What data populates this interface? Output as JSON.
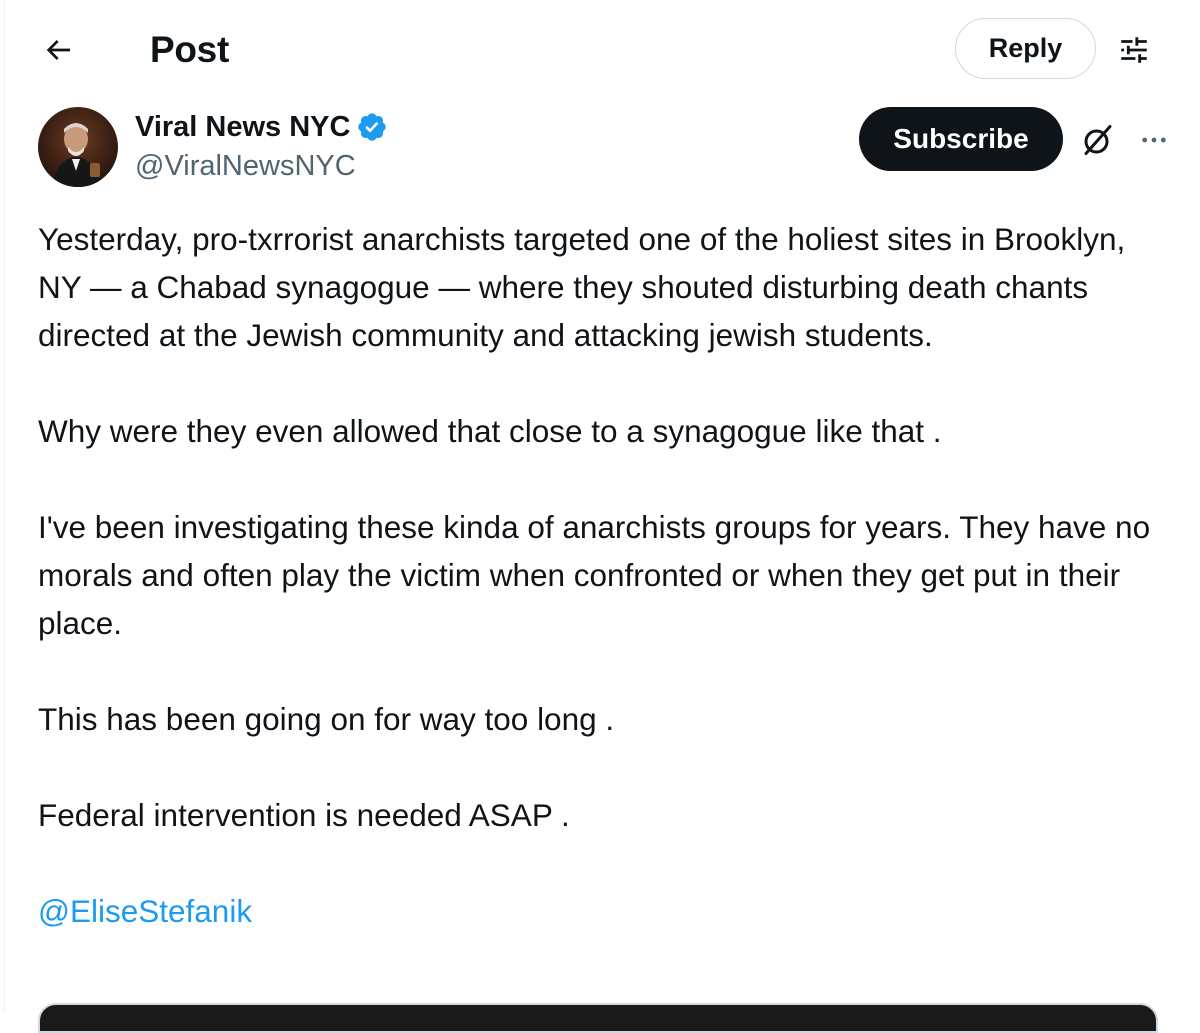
{
  "header": {
    "title": "Post",
    "reply_label": "Reply"
  },
  "author": {
    "name": "Viral News NYC",
    "handle": "@ViralNewsNYC",
    "verified": true,
    "subscribe_label": "Subscribe"
  },
  "post": {
    "paragraphs": [
      "Yesterday, pro-txrrorist anarchists targeted one of the holiest sites in Brooklyn, NY — a Chabad synagogue — where they shouted disturbing death chants directed at the Jewish community and attacking jewish students.",
      "Why were they even allowed that close to a synagogue like that .",
      "I've been investigating these kinda of anarchists groups for years. They have no morals and often play the victim when confronted or when they get put in their place.",
      "This has been going on for way too long .",
      "Federal intervention is needed ASAP ."
    ],
    "mention": "@EliseStefanik"
  },
  "icons": {
    "back": "arrow-left-icon",
    "filter": "sliders-icon",
    "grok": "grok-icon",
    "more": "more-horizontal-icon",
    "verified": "verified-badge-icon"
  },
  "colors": {
    "accent": "#1d9bf0",
    "text": "#0f1419",
    "secondary_text": "#536471",
    "border": "#cfd9de"
  }
}
